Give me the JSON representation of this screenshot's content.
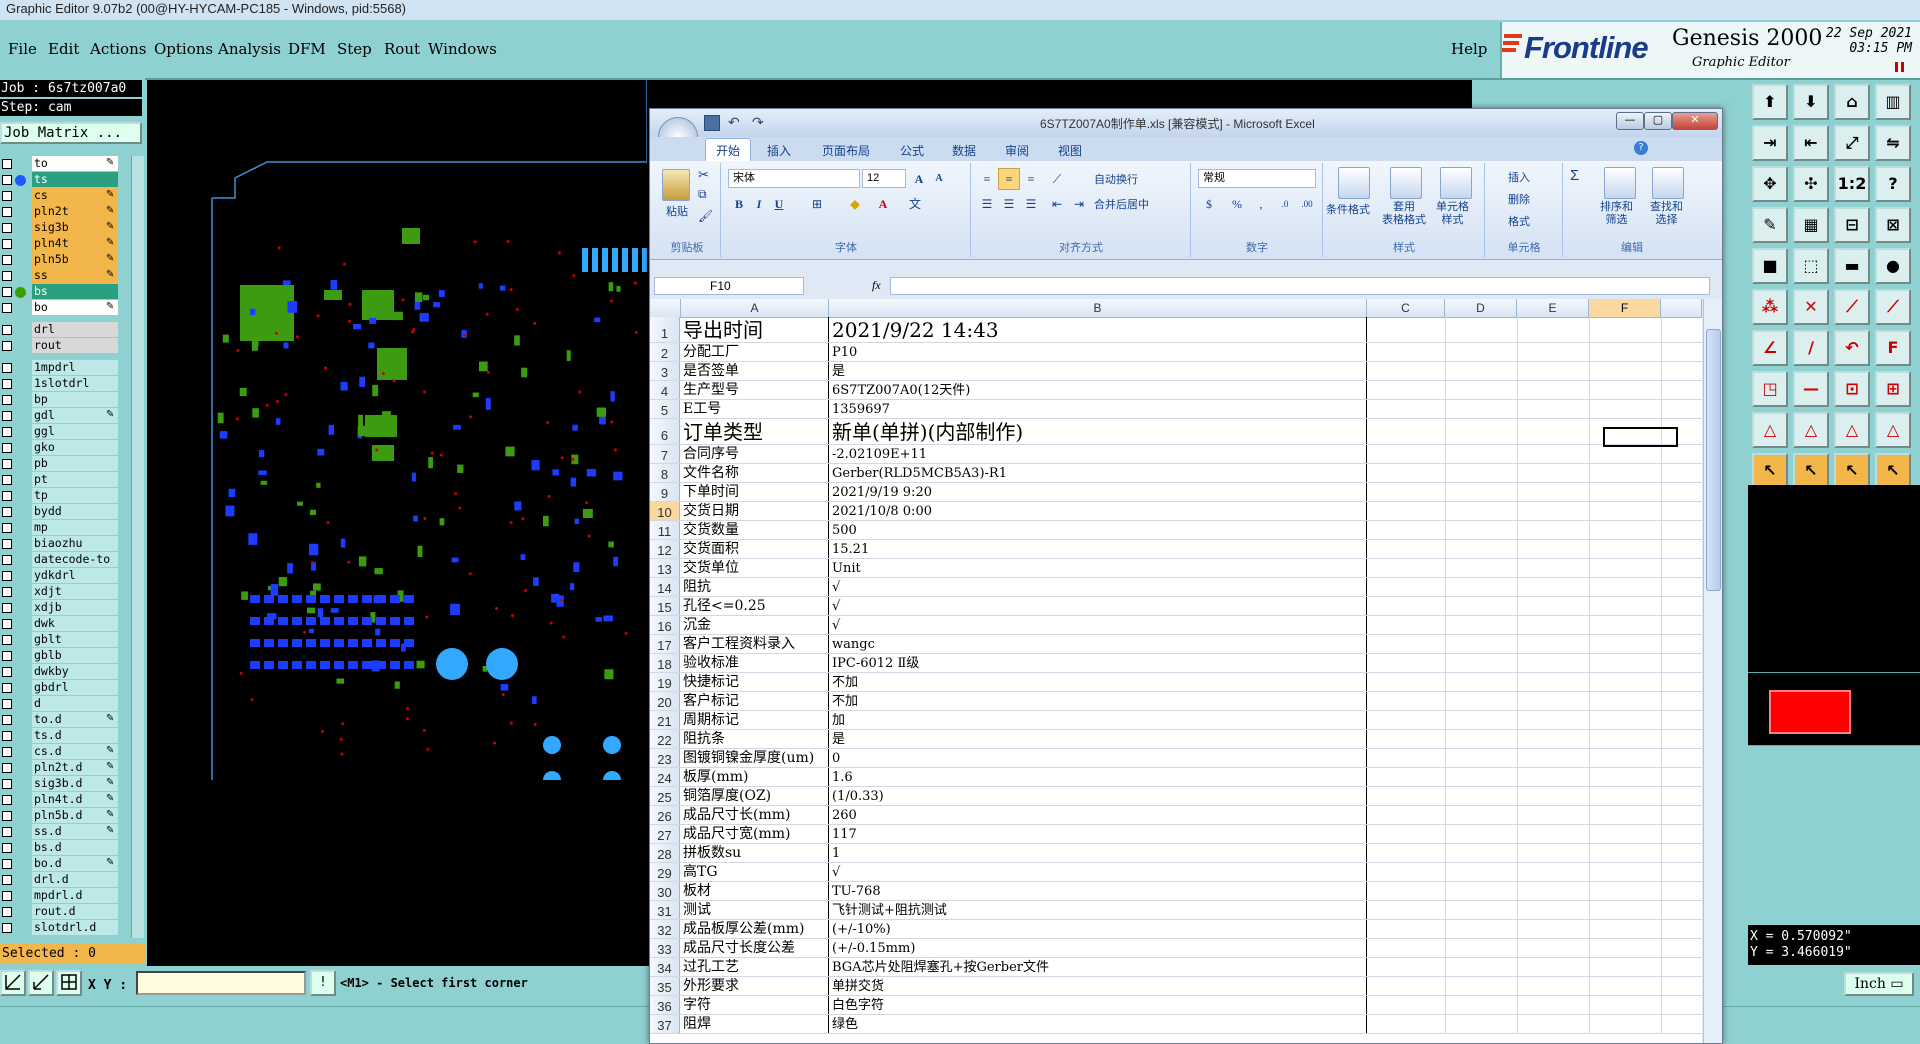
{
  "window_title": "Graphic Editor 9.07b2 (00@HY-HYCAM-PC185 - Windows, pid:5568)",
  "menu": [
    {
      "label": "File"
    },
    {
      "label": "Edit"
    },
    {
      "label": "Actions"
    },
    {
      "label": "Options"
    },
    {
      "label": "Analysis"
    },
    {
      "label": "DFM"
    },
    {
      "label": "Step"
    },
    {
      "label": "Rout"
    },
    {
      "label": "Windows"
    },
    {
      "label": "Help"
    }
  ],
  "brand": {
    "logo": "Frontline",
    "product": "Genesis 2000",
    "subtitle": "Graphic Editor",
    "date": "22 Sep 2021",
    "time": "03:15 PM",
    "accent": "#1a3a8a"
  },
  "job": {
    "job_line": "Job : 6s7tz007a0",
    "step_line": "Step: cam",
    "matrix_button": "Job Matrix ..."
  },
  "layers": [
    {
      "name": "to",
      "style": "filled",
      "dot": "",
      "pen": true
    },
    {
      "name": "ts",
      "style": "green",
      "dot": "#1a5cff",
      "pen": false
    },
    {
      "name": "cs",
      "style": "orange",
      "dot": "",
      "pen": true
    },
    {
      "name": "pln2t",
      "style": "orange",
      "dot": "",
      "pen": true
    },
    {
      "name": "sig3b",
      "style": "orange",
      "dot": "",
      "pen": true
    },
    {
      "name": "pln4t",
      "style": "orange",
      "dot": "",
      "pen": true
    },
    {
      "name": "pln5b",
      "style": "orange",
      "dot": "",
      "pen": true
    },
    {
      "name": "ss",
      "style": "orange",
      "dot": "",
      "pen": true
    },
    {
      "name": "bs",
      "style": "green",
      "dot": "#3aa000",
      "pen": false
    },
    {
      "name": "bo",
      "style": "filled",
      "dot": "",
      "pen": true
    },
    {
      "name": "drl",
      "style": "gray",
      "dot": "",
      "pen": false
    },
    {
      "name": "rout",
      "style": "gray",
      "dot": "",
      "pen": false
    },
    {
      "name": "1mpdrl",
      "style": "cyan",
      "dot": "",
      "pen": false
    },
    {
      "name": "1slotdrl",
      "style": "cyan",
      "dot": "",
      "pen": false
    },
    {
      "name": "bp",
      "style": "cyan",
      "dot": "",
      "pen": false
    },
    {
      "name": "gdl",
      "style": "cyan",
      "dot": "",
      "pen": true
    },
    {
      "name": "ggl",
      "style": "cyan",
      "dot": "",
      "pen": false
    },
    {
      "name": "gko",
      "style": "cyan",
      "dot": "",
      "pen": false
    },
    {
      "name": "pb",
      "style": "cyan",
      "dot": "",
      "pen": false
    },
    {
      "name": "pt",
      "style": "cyan",
      "dot": "",
      "pen": false
    },
    {
      "name": "tp",
      "style": "cyan",
      "dot": "",
      "pen": false
    },
    {
      "name": "bydd",
      "style": "cyan",
      "dot": "",
      "pen": false
    },
    {
      "name": "mp",
      "style": "cyan",
      "dot": "",
      "pen": false
    },
    {
      "name": "biaozhu",
      "style": "cyan",
      "dot": "",
      "pen": false
    },
    {
      "name": "datecode-to",
      "style": "cyan",
      "dot": "",
      "pen": false
    },
    {
      "name": "ydkdrl",
      "style": "cyan",
      "dot": "",
      "pen": false
    },
    {
      "name": "xdjt",
      "style": "cyan",
      "dot": "",
      "pen": false
    },
    {
      "name": "xdjb",
      "style": "cyan",
      "dot": "",
      "pen": false
    },
    {
      "name": "dwk",
      "style": "cyan",
      "dot": "",
      "pen": false
    },
    {
      "name": "gblt",
      "style": "cyan",
      "dot": "",
      "pen": false
    },
    {
      "name": "gblb",
      "style": "cyan",
      "dot": "",
      "pen": false
    },
    {
      "name": "dwkby",
      "style": "cyan",
      "dot": "",
      "pen": false
    },
    {
      "name": "gbdrl",
      "style": "cyan",
      "dot": "",
      "pen": false
    },
    {
      "name": "d",
      "style": "cyan",
      "dot": "",
      "pen": false
    },
    {
      "name": "to.d",
      "style": "cyan",
      "dot": "",
      "pen": true
    },
    {
      "name": "ts.d",
      "style": "cyan",
      "dot": "",
      "pen": false
    },
    {
      "name": "cs.d",
      "style": "cyan",
      "dot": "",
      "pen": true
    },
    {
      "name": "pln2t.d",
      "style": "cyan",
      "dot": "",
      "pen": true
    },
    {
      "name": "sig3b.d",
      "style": "cyan",
      "dot": "",
      "pen": true
    },
    {
      "name": "pln4t.d",
      "style": "cyan",
      "dot": "",
      "pen": true
    },
    {
      "name": "pln5b.d",
      "style": "cyan",
      "dot": "",
      "pen": true
    },
    {
      "name": "ss.d",
      "style": "cyan",
      "dot": "",
      "pen": true
    },
    {
      "name": "bs.d",
      "style": "cyan",
      "dot": "",
      "pen": false
    },
    {
      "name": "bo.d",
      "style": "cyan",
      "dot": "",
      "pen": true
    },
    {
      "name": "drl.d",
      "style": "cyan",
      "dot": "",
      "pen": false
    },
    {
      "name": "mpdrl.d",
      "style": "cyan",
      "dot": "",
      "pen": false
    },
    {
      "name": "rout.d",
      "style": "cyan",
      "dot": "",
      "pen": false
    },
    {
      "name": "slotdrl.d",
      "style": "cyan",
      "dot": "",
      "pen": false
    }
  ],
  "selected_text": "Selected : 0",
  "xy_label": "X Y :",
  "xy_value": "",
  "prompt": "<M1> - Select first corner",
  "coords": {
    "x": "X = 0.570092\"",
    "y": "Y = 3.466019\""
  },
  "units_button": "Inch",
  "excel": {
    "title": "6S7TZ007A0制作单.xls  [兼容模式]  -  Microsoft Excel",
    "tabs": [
      "开始",
      "插入",
      "页面布局",
      "公式",
      "数据",
      "审阅",
      "视图"
    ],
    "active_tab": "开始",
    "ribbon": {
      "paste": "粘贴",
      "clipboard": "剪贴板",
      "font_name": "宋体",
      "font_size": "12",
      "font_group": "字体",
      "wrap": "自动换行",
      "merge": "合并后居中",
      "align_group": "对齐方式",
      "number_format": "常规",
      "number_group": "数字",
      "cond_format": "条件格式",
      "table_format": "套用\n表格格式",
      "cell_style": "单元格\n样式",
      "style_group": "样式",
      "insert": "插入",
      "delete": "删除",
      "format": "格式",
      "cells_group": "单元格",
      "sort": "排序和\n筛选",
      "find": "查找和\n选择",
      "edit_group": "编辑"
    },
    "name_box": "F10",
    "fx": "fx",
    "columns": [
      "A",
      "B",
      "C",
      "D",
      "E",
      "F"
    ],
    "selected_column": "F",
    "selected_row": "10",
    "rows": [
      {
        "n": "1",
        "a": "导出时间",
        "b": "2021/9/22 14:43",
        "big": true
      },
      {
        "n": "2",
        "a": "分配工厂",
        "b": "P10"
      },
      {
        "n": "3",
        "a": "是否签单",
        "b": "是"
      },
      {
        "n": "4",
        "a": "生产型号",
        "b": "6S7TZ007A0(12天件)"
      },
      {
        "n": "5",
        "a": "E工号",
        "b": "1359697"
      },
      {
        "n": "6",
        "a": "订单类型",
        "b": "新单(单拼)(内部制作)",
        "big": true
      },
      {
        "n": "7",
        "a": "合同序号",
        "b": "-2.02109E+11"
      },
      {
        "n": "8",
        "a": "文件名称",
        "b": "Gerber(RLD5MCB5A3)-R1"
      },
      {
        "n": "9",
        "a": "下单时间",
        "b": "2021/9/19 9:20"
      },
      {
        "n": "10",
        "a": "交货日期",
        "b": "2021/10/8 0:00"
      },
      {
        "n": "11",
        "a": "交货数量",
        "b": "500"
      },
      {
        "n": "12",
        "a": "交货面积",
        "b": "15.21"
      },
      {
        "n": "13",
        "a": "交货单位",
        "b": "Unit"
      },
      {
        "n": "14",
        "a": "阻抗",
        "b": "√"
      },
      {
        "n": "15",
        "a": "孔径<=0.25",
        "b": "√"
      },
      {
        "n": "16",
        "a": "沉金",
        "b": "√"
      },
      {
        "n": "17",
        "a": "客户工程资料录入",
        "b": "wangc"
      },
      {
        "n": "18",
        "a": "验收标准",
        "b": "IPC-6012 Ⅱ级"
      },
      {
        "n": "19",
        "a": "快捷标记",
        "b": "不加"
      },
      {
        "n": "20",
        "a": "客户标记",
        "b": "不加"
      },
      {
        "n": "21",
        "a": "周期标记",
        "b": "加"
      },
      {
        "n": "22",
        "a": "阻抗条",
        "b": "是"
      },
      {
        "n": "23",
        "a": "图镀铜镍金厚度(um)",
        "b": "0"
      },
      {
        "n": "24",
        "a": "板厚(mm)",
        "b": "1.6"
      },
      {
        "n": "25",
        "a": "铜箔厚度(OZ)",
        "b": " (1/0.33)"
      },
      {
        "n": "26",
        "a": "成品尺寸长(mm)",
        "b": "260"
      },
      {
        "n": "27",
        "a": "成品尺寸宽(mm)",
        "b": "117"
      },
      {
        "n": "28",
        "a": "拼板数su",
        "b": "1"
      },
      {
        "n": "29",
        "a": "高TG",
        "b": "√"
      },
      {
        "n": "30",
        "a": "板材",
        "b": "TU-768"
      },
      {
        "n": "31",
        "a": "测试",
        "b": "飞针测试+阻抗测试"
      },
      {
        "n": "32",
        "a": "成品板厚公差(mm)",
        "b": "(+/-10%)"
      },
      {
        "n": "33",
        "a": "成品尺寸长度公差",
        "b": "(+/-0.15mm)"
      },
      {
        "n": "34",
        "a": "过孔工艺",
        "b": "BGA芯片处阻焊塞孔+按Gerber文件"
      },
      {
        "n": "35",
        "a": "外形要求",
        "b": "单拼交货"
      },
      {
        "n": "36",
        "a": "字符",
        "b": "白色字符"
      },
      {
        "n": "37",
        "a": "阻焊",
        "b": "绿色"
      }
    ]
  },
  "colors": {
    "bg": "#8fd0d0",
    "pcb_green": "#3c9b10",
    "pcb_blue": "#1e3cff",
    "pcb_cyan": "#33a8ff"
  }
}
